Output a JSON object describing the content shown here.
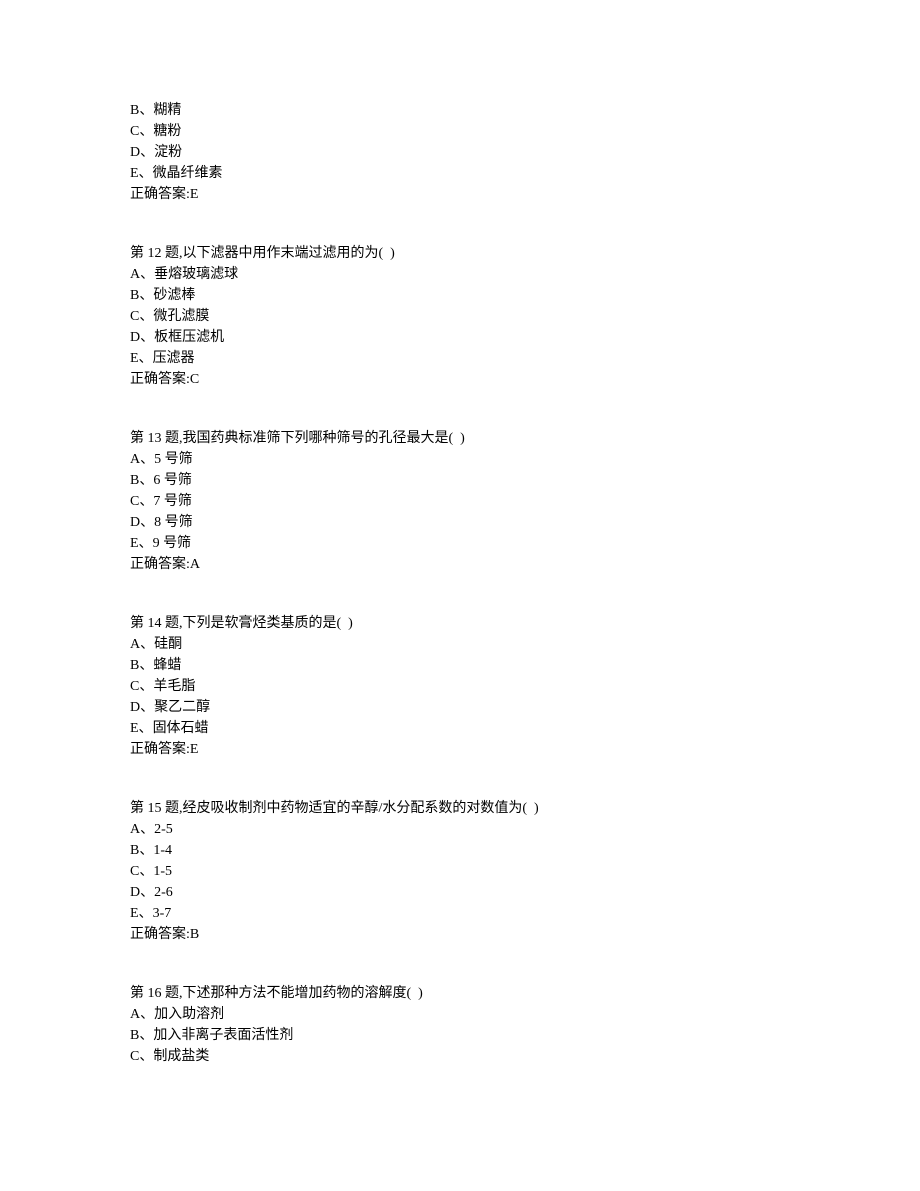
{
  "partial_question_top": {
    "options": [
      {
        "label": "B、",
        "text": "糊精"
      },
      {
        "label": "C、",
        "text": "糖粉"
      },
      {
        "label": "D、",
        "text": "淀粉"
      },
      {
        "label": "E、",
        "text": "微晶纤维素"
      }
    ],
    "answer_prefix": "正确答案:",
    "answer": "E"
  },
  "questions": [
    {
      "header_prefix": "第 12 题,",
      "stem": "以下滤器中用作末端过滤用的为(  )",
      "options": [
        {
          "label": "A、",
          "text": "垂熔玻璃滤球"
        },
        {
          "label": "B、",
          "text": "砂滤棒"
        },
        {
          "label": "C、",
          "text": "微孔滤膜"
        },
        {
          "label": "D、",
          "text": "板框压滤机"
        },
        {
          "label": "E、",
          "text": "压滤器"
        }
      ],
      "answer_prefix": "正确答案:",
      "answer": "C"
    },
    {
      "header_prefix": "第 13 题,",
      "stem": "我国药典标准筛下列哪种筛号的孔径最大是(  )",
      "options": [
        {
          "label": "A、",
          "text": "5 号筛"
        },
        {
          "label": "B、",
          "text": "6 号筛"
        },
        {
          "label": "C、",
          "text": "7 号筛"
        },
        {
          "label": "D、",
          "text": "8 号筛"
        },
        {
          "label": "E、",
          "text": "9 号筛"
        }
      ],
      "answer_prefix": "正确答案:",
      "answer": "A"
    },
    {
      "header_prefix": "第 14 题,",
      "stem": "下列是软膏烃类基质的是(  )",
      "options": [
        {
          "label": "A、",
          "text": "硅酮"
        },
        {
          "label": "B、",
          "text": "蜂蜡"
        },
        {
          "label": "C、",
          "text": "羊毛脂"
        },
        {
          "label": "D、",
          "text": "聚乙二醇"
        },
        {
          "label": "E、",
          "text": "固体石蜡"
        }
      ],
      "answer_prefix": "正确答案:",
      "answer": "E"
    },
    {
      "header_prefix": "第 15 题,",
      "stem": "经皮吸收制剂中药物适宜的辛醇/水分配系数的对数值为(  )",
      "options": [
        {
          "label": "A、",
          "text": "2-5"
        },
        {
          "label": "B、",
          "text": "1-4"
        },
        {
          "label": "C、",
          "text": "1-5"
        },
        {
          "label": "D、",
          "text": "2-6"
        },
        {
          "label": "E、",
          "text": "3-7"
        }
      ],
      "answer_prefix": "正确答案:",
      "answer": "B"
    },
    {
      "header_prefix": "第 16 题,",
      "stem": "下述那种方法不能增加药物的溶解度(  )",
      "options": [
        {
          "label": "A、",
          "text": "加入助溶剂"
        },
        {
          "label": "B、",
          "text": "加入非离子表面活性剂"
        },
        {
          "label": "C、",
          "text": "制成盐类"
        }
      ],
      "answer_prefix": "",
      "answer": ""
    }
  ]
}
